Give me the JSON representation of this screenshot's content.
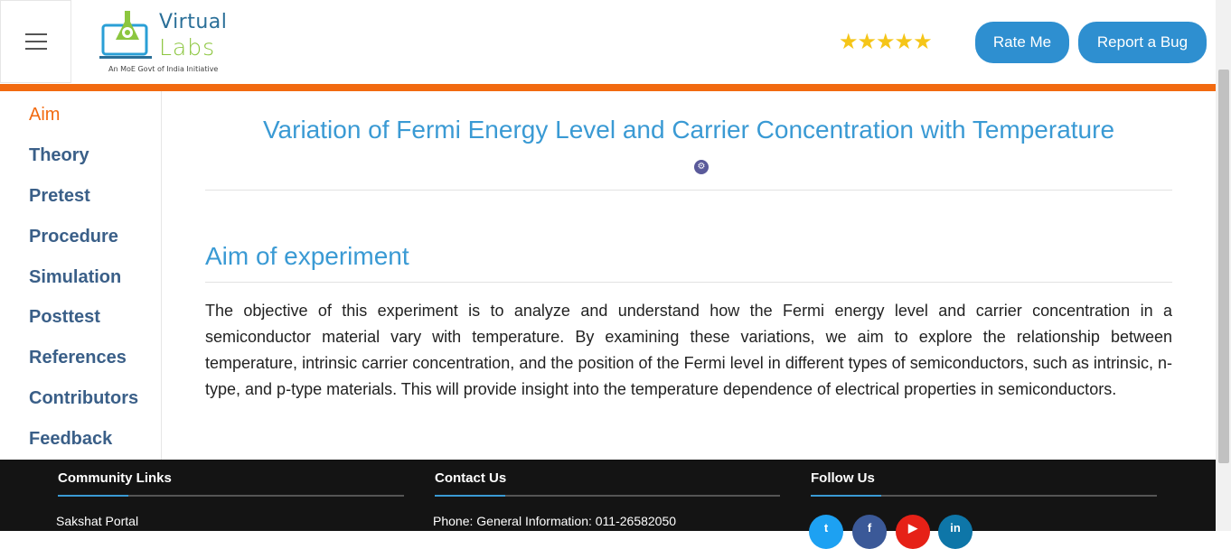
{
  "header": {
    "logo": {
      "word1": "Virtual",
      "word2": "Labs",
      "tagline": "An MoE Govt of India Initiative"
    },
    "rating_stars": "★★★★★",
    "rate_button": "Rate Me",
    "bug_button": "Report a Bug",
    "accent_color": "#f26a10",
    "button_color": "#2e8fd0"
  },
  "sidebar": {
    "items": [
      {
        "label": "Aim",
        "active": true
      },
      {
        "label": "Theory"
      },
      {
        "label": "Pretest"
      },
      {
        "label": "Procedure"
      },
      {
        "label": "Simulation"
      },
      {
        "label": "Posttest"
      },
      {
        "label": "References"
      },
      {
        "label": "Contributors"
      },
      {
        "label": "Feedback"
      }
    ]
  },
  "main": {
    "title": "Variation of Fermi Energy Level and Carrier Concentration with Temperature",
    "section_heading": "Aim of experiment",
    "paragraph": "The objective of this experiment is to analyze and understand how the Fermi energy level and carrier concentration in a semiconductor material vary with temperature. By examining these variations, we aim to explore the relationship between temperature, intrinsic carrier concentration, and the position of the Fermi level in different types of semiconductors, such as intrinsic, n-type, and p-type materials. This will provide insight into the temperature dependence of electrical properties in semiconductors."
  },
  "footer": {
    "community": {
      "heading": "Community Links",
      "first_link": "Sakshat Portal"
    },
    "contact": {
      "heading": "Contact Us",
      "phone": "Phone: General Information: 011-26582050"
    },
    "follow": {
      "heading": "Follow Us",
      "icons": [
        {
          "name": "twitter-icon",
          "glyph": "t",
          "color": "#1da1f2"
        },
        {
          "name": "facebook-icon",
          "glyph": "f",
          "color": "#3b5998"
        },
        {
          "name": "youtube-icon",
          "glyph": "▶",
          "color": "#e62117"
        },
        {
          "name": "linkedin-icon",
          "glyph": "in",
          "color": "#0e76a8"
        }
      ]
    }
  }
}
